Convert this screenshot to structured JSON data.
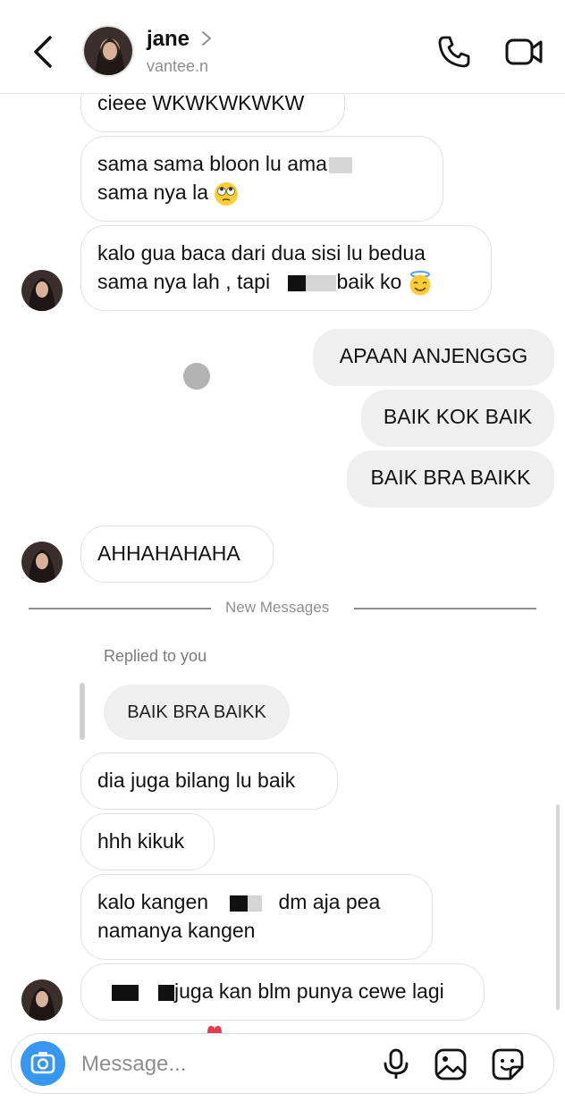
{
  "header": {
    "name": "jane",
    "username": "vantee.n"
  },
  "messages": {
    "m1": "cieee WKWKWKWKW",
    "m2_line1": "sama sama bloon lu ama",
    "m2_line2": "sama nya la",
    "m3_line1": "kalo gua baca dari dua sisi lu bedua",
    "m3_line2_a": "sama nya lah , tapi",
    "m3_line2_b": "baik ko",
    "me1": "APAAN ANJENGGG",
    "me2": "BAIK KOK BAIK",
    "me3": "BAIK BRA BAIKK",
    "m4": "AHHAHAHAHA",
    "new_messages": "New Messages",
    "replied_label": "Replied to you",
    "reply_quote": "BAIK BRA BAIKK",
    "m5": "dia juga bilang lu baik",
    "m6": "hhh kikuk",
    "m7_line1_a": "kalo kangen",
    "m7_line1_b": "dm aja pea",
    "m7_line2": "namanya kangen",
    "m8": "juga kan blm punya cewe lagi"
  },
  "composer": {
    "placeholder": "Message..."
  },
  "icons": {
    "back": "chevron-left-icon",
    "phone": "phone-icon",
    "video": "video-icon",
    "camera": "camera-icon",
    "mic": "microphone-icon",
    "gallery": "gallery-icon",
    "sticker": "sticker-icon",
    "emoji_eyes": "rolling-eyes-emoji",
    "emoji_halo": "smiling-halo-emoji"
  },
  "colors": {
    "accent": "#3797f0",
    "sent_bubble": "#efefef",
    "muted_text": "#8e8e8e"
  }
}
